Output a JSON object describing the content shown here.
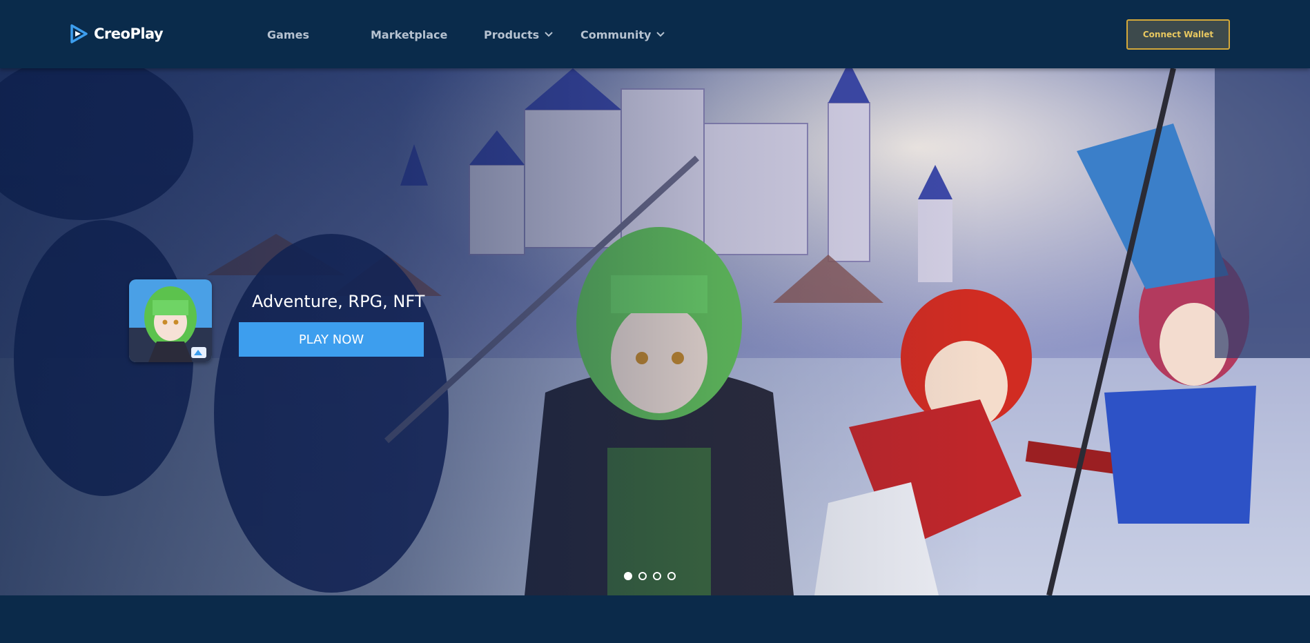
{
  "brand": {
    "name": "CreoPlay",
    "accent": "#3d9eee",
    "header_bg": "#0a2b4b"
  },
  "nav": {
    "items": [
      {
        "label": "Games",
        "has_dropdown": false
      },
      {
        "label": "Marketplace",
        "has_dropdown": false
      },
      {
        "label": "Products",
        "has_dropdown": true
      },
      {
        "label": "Community",
        "has_dropdown": true
      }
    ],
    "connect_wallet": "Connect Wallet"
  },
  "hero": {
    "genre": "Adventure, RPG, NFT",
    "cta": "PLAY NOW",
    "slides_total": 4,
    "active_slide": 1
  },
  "icons": {
    "logo": "play-triangle-logo-icon",
    "dropdown": "chevron-down-icon"
  }
}
